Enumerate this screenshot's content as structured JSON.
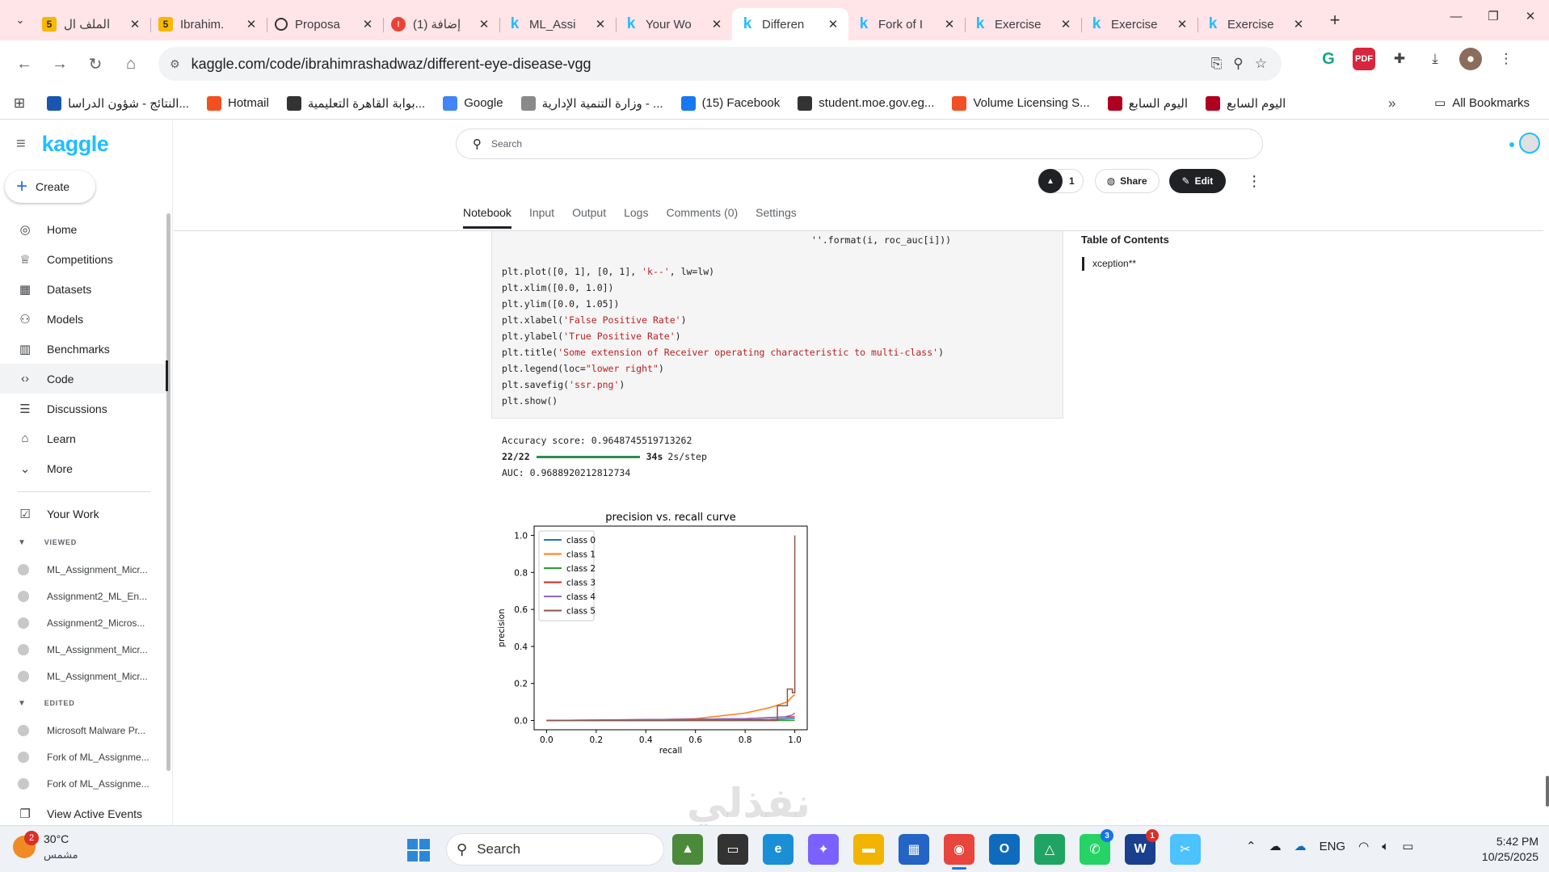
{
  "browser": {
    "tabs": [
      {
        "title": "الملف ال",
        "icon": "five-icon"
      },
      {
        "title": "Ibrahim.",
        "icon": "five-icon"
      },
      {
        "title": "Proposa",
        "icon": "openai-icon"
      },
      {
        "title": "(1) إضافة",
        "icon": "notification-icon"
      },
      {
        "title": "ML_Assi",
        "icon": "kaggle-icon"
      },
      {
        "title": "Your Wo",
        "icon": "kaggle-icon"
      },
      {
        "title": "Differen",
        "icon": "kaggle-icon",
        "active": true
      },
      {
        "title": "Fork of I",
        "icon": "kaggle-icon"
      },
      {
        "title": "Exercise",
        "icon": "kaggle-icon"
      },
      {
        "title": "Exercise",
        "icon": "kaggle-icon"
      },
      {
        "title": "Exercise",
        "icon": "kaggle-icon"
      }
    ],
    "url": "kaggle.com/code/ibrahimrashadwaz/different-eye-disease-vgg",
    "bookmarks": [
      {
        "label": "النتائج - شؤون الدراسا...",
        "color": "#1a56b0"
      },
      {
        "label": "Hotmail",
        "color": "#f25022"
      },
      {
        "label": "بوابة القاهرة التعليمية...",
        "color": "#333333"
      },
      {
        "label": "Google",
        "color": "#4285f4"
      },
      {
        "label": "وزارة التنمية الإدارية - ...",
        "color": "#8a8a8a"
      },
      {
        "label": "(15) Facebook",
        "color": "#1877f2"
      },
      {
        "label": "student.moe.gov.eg...",
        "color": "#333333"
      },
      {
        "label": "Volume Licensing S...",
        "color": "#f25022"
      },
      {
        "label": "اليوم السابع",
        "color": "#b00020"
      },
      {
        "label": "اليوم السابع",
        "color": "#b00020"
      }
    ],
    "all_bookmarks": "All Bookmarks"
  },
  "kaggle": {
    "logo": "kaggle",
    "create_label": "Create",
    "nav": [
      {
        "label": "Home",
        "icon": "compass-icon",
        "glyph": "◎"
      },
      {
        "label": "Competitions",
        "icon": "trophy-icon",
        "glyph": "♕"
      },
      {
        "label": "Datasets",
        "icon": "table-icon",
        "glyph": "▦"
      },
      {
        "label": "Models",
        "icon": "models-icon",
        "glyph": "⚇"
      },
      {
        "label": "Benchmarks",
        "icon": "bar-chart-icon",
        "glyph": "▥"
      },
      {
        "label": "Code",
        "icon": "code-icon",
        "glyph": "‹›",
        "active": true
      },
      {
        "label": "Discussions",
        "icon": "comment-icon",
        "glyph": "☰"
      },
      {
        "label": "Learn",
        "icon": "graduation-cap-icon",
        "glyph": "⌂"
      },
      {
        "label": "More",
        "icon": "chevron-down-icon",
        "glyph": "⌄"
      }
    ],
    "your_work": "Your Work",
    "viewed_label": "VIEWED",
    "viewed": [
      "ML_Assignment_Micr...",
      "Assignment2_ML_En...",
      "Assignment2_Micros...",
      "ML_Assignment_Micr...",
      "ML_Assignment_Micr..."
    ],
    "edited_label": "EDITED",
    "edited": [
      "Microsoft Malware Pr...",
      "Fork of ML_Assignme...",
      "Fork of ML_Assignme..."
    ],
    "view_active_events": "View Active Events",
    "search_placeholder": "Search",
    "vote_count": "1",
    "share_label": "Share",
    "edit_label": "Edit",
    "notebook_tabs": [
      "Notebook",
      "Input",
      "Output",
      "Logs",
      "Comments (0)",
      "Settings"
    ],
    "toc_title": "Table of Contents",
    "toc_items": [
      "xception**"
    ]
  },
  "code": {
    "line0": "''.format(i, roc_auc[i]))",
    "line1a": "plt.plot([0, 1], [0, 1], ",
    "line1s": "'k--'",
    "line1b": ", lw=lw)",
    "line2": "plt.xlim([0.0, 1.0])",
    "line3": "plt.ylim([0.0, 1.05])",
    "line4a": "plt.xlabel(",
    "line4s": "'False Positive Rate'",
    "line4b": ")",
    "line5a": "plt.ylabel(",
    "line5s": "'True Positive Rate'",
    "line5b": ")",
    "line6a": "plt.title(",
    "line6s": "'Some extension of Receiver operating characteristic to multi-class'",
    "line6b": ")",
    "line7a": "plt.legend(loc=",
    "line7s": "\"lower right\"",
    "line7b": ")",
    "line8a": "plt.savefig(",
    "line8s": "'ssr.png'",
    "line8b": ")",
    "line9": "plt.show()"
  },
  "output": {
    "accuracy": "Accuracy score: 0.9648745519713262",
    "steps": "22/22",
    "progress": 1.0,
    "duration": "34s",
    "per_step": "2s/step",
    "auc": "AUC: 0.9688920212812734"
  },
  "chart_data": {
    "type": "line",
    "title": "precision vs. recall curve",
    "xlabel": "recall",
    "ylabel": "precision",
    "xlim": [
      -0.05,
      1.05
    ],
    "ylim": [
      -0.05,
      1.05
    ],
    "xticks": [
      "0.0",
      "0.2",
      "0.4",
      "0.6",
      "0.8",
      "1.0"
    ],
    "yticks": [
      "0.0",
      "0.2",
      "0.4",
      "0.6",
      "0.8",
      "1.0"
    ],
    "legend_position": "top-left",
    "grid": false,
    "series": [
      {
        "name": "class 0",
        "color": "#1f77b4",
        "points": [
          [
            0.0,
            0.0
          ],
          [
            0.5,
            0.0
          ],
          [
            0.9,
            0.005
          ],
          [
            0.99,
            0.01
          ],
          [
            1.0,
            0.01
          ]
        ]
      },
      {
        "name": "class 1",
        "color": "#ff7f0e",
        "points": [
          [
            0.0,
            0.0
          ],
          [
            0.4,
            0.003
          ],
          [
            0.6,
            0.01
          ],
          [
            0.8,
            0.04
          ],
          [
            0.9,
            0.07
          ],
          [
            0.97,
            0.1
          ],
          [
            0.99,
            0.13
          ],
          [
            1.0,
            0.14
          ]
        ]
      },
      {
        "name": "class 2",
        "color": "#2ca02c",
        "points": [
          [
            0.0,
            0.0
          ],
          [
            0.9,
            0.0
          ],
          [
            1.0,
            0.0
          ]
        ]
      },
      {
        "name": "class 3",
        "color": "#d62728",
        "points": [
          [
            0.0,
            0.0
          ],
          [
            0.8,
            0.01
          ],
          [
            1.0,
            0.02
          ]
        ]
      },
      {
        "name": "class 4",
        "color": "#9467bd",
        "points": [
          [
            0.0,
            0.0
          ],
          [
            0.8,
            0.01
          ],
          [
            0.96,
            0.02
          ],
          [
            0.99,
            0.03
          ],
          [
            1.0,
            0.04
          ]
        ]
      },
      {
        "name": "class 5",
        "color": "#8c564b",
        "points": [
          [
            0.0,
            0.0
          ],
          [
            0.93,
            0.0
          ],
          [
            0.93,
            0.08
          ],
          [
            0.97,
            0.08
          ],
          [
            0.97,
            0.17
          ],
          [
            0.99,
            0.17
          ],
          [
            0.99,
            0.15
          ],
          [
            1.0,
            0.15
          ],
          [
            1.0,
            1.0
          ]
        ]
      }
    ]
  },
  "taskbar": {
    "temperature": "30°C",
    "condition": "مشمس",
    "weather_badge": "2",
    "search_label": "Search",
    "apps": [
      {
        "name": "photos-icon",
        "glyph": "▲",
        "bg": "#4a8a3a"
      },
      {
        "name": "task-view-icon",
        "glyph": "▭",
        "bg": "#333333"
      },
      {
        "name": "edge-icon",
        "glyph": "e",
        "bg": "#1a8fd6"
      },
      {
        "name": "copilot-icon",
        "glyph": "✦",
        "bg": "#7b61ff"
      },
      {
        "name": "file-explorer-icon",
        "glyph": "▬",
        "bg": "#f2b400"
      },
      {
        "name": "store-icon",
        "glyph": "▦",
        "bg": "#2364c6"
      },
      {
        "name": "chrome-icon",
        "glyph": "◉",
        "bg": "#e8453c",
        "active": true
      },
      {
        "name": "outlook-icon",
        "glyph": "O",
        "bg": "#0f6cbd"
      },
      {
        "name": "drive-icon",
        "glyph": "△",
        "bg": "#1fa463"
      },
      {
        "name": "whatsapp-icon",
        "glyph": "✆",
        "bg": "#25d366",
        "badge": "3"
      },
      {
        "name": "word-icon",
        "glyph": "W",
        "bg": "#1b3f8f",
        "badge": "1"
      },
      {
        "name": "snipping-icon",
        "glyph": "✂",
        "bg": "#4cc2ff"
      }
    ],
    "language": "ENG",
    "time": "5:42 PM",
    "date": "10/25/2025"
  }
}
